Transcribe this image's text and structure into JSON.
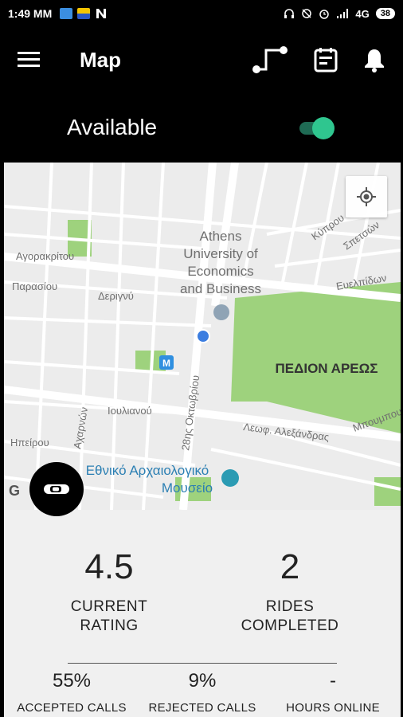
{
  "status_bar": {
    "time": "1:49 MM",
    "network": "4G",
    "battery": "38"
  },
  "header": {
    "title": "Map"
  },
  "availability": {
    "label": "Available",
    "enabled": true,
    "accent": "#2fc68f"
  },
  "map": {
    "labels": {
      "university": [
        "Athens",
        "University of",
        "Economics",
        "and Business"
      ],
      "park": "ΠΕΔΙΟΝ ΑΡΕΩΣ",
      "museum": [
        "Εθνικό Αρχαιολογικό",
        "Μουσείο"
      ],
      "streets": {
        "agorakritou": "Αγορακρίτου",
        "parasiou": "Παρασίου",
        "derignu": "Δεριγνύ",
        "ioulianou": "Ιουλιανού",
        "ipirou": "Ηπείρου",
        "acharnon": "Αχαρνών",
        "oktovriou": "28ης Οκτωβρίου",
        "alexandras": "Λεωφ. Αλεξάνδρας",
        "kyprou": "Κύπρου",
        "spetson": "Σπετσών",
        "evelpidon": "Ευελπίδων",
        "mpoumpou": "Μπουμπου"
      },
      "metro": "M",
      "attribution": "G"
    }
  },
  "stats": {
    "rating": {
      "value": "4.5",
      "label_line1": "CURRENT",
      "label_line2": "RATING"
    },
    "rides": {
      "value": "2",
      "label_line1": "RIDES",
      "label_line2": "COMPLETED"
    },
    "accepted": {
      "value": "55%",
      "label": "ACCEPTED CALLS"
    },
    "rejected": {
      "value": "9%",
      "label": "REJECTED CALLS"
    },
    "hours": {
      "value": "-",
      "label": "HOURS ONLINE"
    }
  }
}
